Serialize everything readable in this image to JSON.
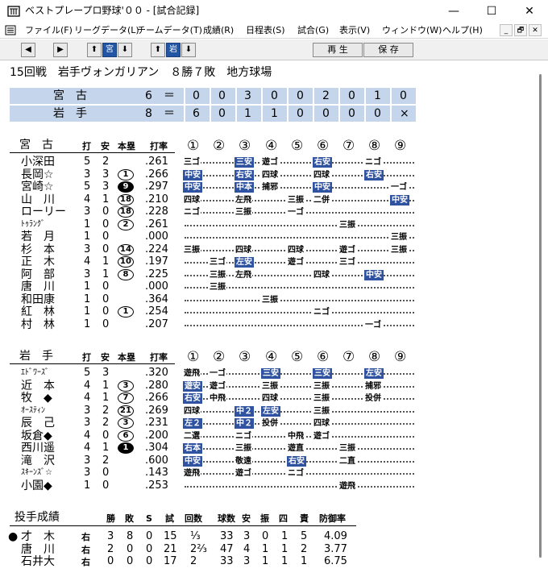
{
  "window": {
    "title": "ベストプレープロ野球'００ - [試合記録]",
    "minimize": "—",
    "maximize": "☐",
    "close": "✕"
  },
  "menu": [
    "ファイル(F)",
    "リーグデータ(L)",
    "チームデータ(T)",
    "成績(R)",
    "日程表(S)",
    "試合(G)",
    "表示(V)",
    "ウィンドウ(W)",
    "ヘルプ(H)"
  ],
  "mdi": {
    "min": "_",
    "restore": "🗗",
    "close": "✕"
  },
  "toolbar": {
    "prev": "◀",
    "next": "▶",
    "up1": "⬆",
    "team1": "宮",
    "down1": "⬇",
    "up2": "⬆",
    "team2": "岩",
    "down2": "⬇",
    "play": "再 生",
    "save": "保 存"
  },
  "game": {
    "info": "15回戦　岩手ヴォンガリアン　８勝７敗　地方球場"
  },
  "score": {
    "rows": [
      {
        "team": "宮　古",
        "total": "6",
        "eq": "＝",
        "innings": [
          "0",
          "0",
          "3",
          "0",
          "0",
          "2",
          "0",
          "1",
          "0"
        ]
      },
      {
        "team": "岩　手",
        "total": "8",
        "eq": "＝",
        "innings": [
          "6",
          "0",
          "1",
          "1",
          "0",
          "0",
          "0",
          "0",
          "×"
        ]
      }
    ]
  },
  "headers": {
    "ab": "打",
    "h": "安",
    "hr": "本塁",
    "avg": "打率",
    "innings": [
      "①",
      "②",
      "③",
      "④",
      "⑤",
      "⑥",
      "⑦",
      "⑧",
      "⑨"
    ]
  },
  "teams": [
    {
      "name": "宮　古",
      "players": [
        {
          "name": "小深田",
          "ab": "5",
          "h": "2",
          "hr": "",
          "hrfill": false,
          "avg": ".261",
          "ev": [
            {
              "i": 0,
              "t": "三ゴ",
              "h": false
            },
            {
              "i": 2,
              "t": "三安",
              "h": true
            },
            {
              "i": 3,
              "t": "遊ゴ",
              "h": false
            },
            {
              "i": 5,
              "t": "右安",
              "h": true
            },
            {
              "i": 7,
              "t": "ニゴ",
              "h": false
            }
          ]
        },
        {
          "name": "長岡☆",
          "ab": "3",
          "h": "3",
          "hr": "1",
          "hrfill": false,
          "avg": ".266",
          "ev": [
            {
              "i": 0,
              "t": "中安",
              "h": true
            },
            {
              "i": 2,
              "t": "右安",
              "h": true
            },
            {
              "i": 3,
              "t": "四球",
              "h": false
            },
            {
              "i": 5,
              "t": "四球",
              "h": false
            },
            {
              "i": 7,
              "t": "右安",
              "h": true
            }
          ]
        },
        {
          "name": "宮崎☆",
          "ab": "5",
          "h": "3",
          "hr": "9",
          "hrfill": true,
          "avg": ".297",
          "ev": [
            {
              "i": 0,
              "t": "中安",
              "h": true
            },
            {
              "i": 2,
              "t": "中本",
              "h": true
            },
            {
              "i": 3,
              "t": "捕邪",
              "h": false
            },
            {
              "i": 5,
              "t": "中安",
              "h": true
            },
            {
              "i": 8,
              "t": "一ゴ",
              "h": false
            }
          ]
        },
        {
          "name": "山　川",
          "ab": "4",
          "h": "1",
          "hr": "18",
          "hrfill": false,
          "avg": ".210",
          "ev": [
            {
              "i": 0,
              "t": "四球",
              "h": false
            },
            {
              "i": 2,
              "t": "左飛",
              "h": false
            },
            {
              "i": 4,
              "t": "三振",
              "h": false
            },
            {
              "i": 5,
              "t": "二併",
              "h": false
            },
            {
              "i": 8,
              "t": "中安",
              "h": true
            }
          ]
        },
        {
          "name": "ローリー",
          "ab": "3",
          "h": "0",
          "hr": "18",
          "hrfill": false,
          "avg": ".228",
          "ev": [
            {
              "i": 0,
              "t": "ニゴ",
              "h": false
            },
            {
              "i": 2,
              "t": "三振",
              "h": false
            },
            {
              "i": 4,
              "t": "一ゴ",
              "h": false
            }
          ]
        },
        {
          "name": "ﾄｩﾗﾝｸﾞ",
          "ab": "1",
          "h": "0",
          "hr": "2",
          "hrfill": false,
          "avg": ".261",
          "ev": [
            {
              "i": 6,
              "t": "三振",
              "h": false
            }
          ]
        },
        {
          "name": "若　月",
          "ab": "1",
          "h": "0",
          "hr": "",
          "hrfill": false,
          "avg": ".000",
          "ev": [
            {
              "i": 8,
              "t": "三振",
              "h": false
            }
          ]
        },
        {
          "name": "杉　本",
          "ab": "3",
          "h": "0",
          "hr": "14",
          "hrfill": false,
          "avg": ".224",
          "ev": [
            {
              "i": 0,
              "t": "三振",
              "h": false
            },
            {
              "i": 2,
              "t": "四球",
              "h": false
            },
            {
              "i": 4,
              "t": "四球",
              "h": false
            },
            {
              "i": 6,
              "t": "遊ゴ",
              "h": false
            },
            {
              "i": 8,
              "t": "三振",
              "h": false
            }
          ]
        },
        {
          "name": "正　木",
          "ab": "4",
          "h": "1",
          "hr": "10",
          "hrfill": false,
          "avg": ".197",
          "ev": [
            {
              "i": 1,
              "t": "三ゴ",
              "h": false
            },
            {
              "i": 2,
              "t": "左安",
              "h": true
            },
            {
              "i": 4,
              "t": "遊ゴ",
              "h": false
            },
            {
              "i": 6,
              "t": "三ゴ",
              "h": false
            }
          ]
        },
        {
          "name": "阿　部",
          "ab": "3",
          "h": "1",
          "hr": "8",
          "hrfill": false,
          "avg": ".225",
          "ev": [
            {
              "i": 1,
              "t": "三振",
              "h": false
            },
            {
              "i": 2,
              "t": "左飛",
              "h": false
            },
            {
              "i": 5,
              "t": "四球",
              "h": false
            },
            {
              "i": 7,
              "t": "中安",
              "h": true
            }
          ]
        },
        {
          "name": "唐　川",
          "ab": "1",
          "h": "0",
          "hr": "",
          "hrfill": false,
          "avg": ".000",
          "ev": [
            {
              "i": 1,
              "t": "三振",
              "h": false
            }
          ]
        },
        {
          "name": "和田康",
          "ab": "1",
          "h": "0",
          "hr": "",
          "hrfill": false,
          "avg": ".364",
          "ev": [
            {
              "i": 3,
              "t": "三振",
              "h": false
            }
          ]
        },
        {
          "name": "紅　林",
          "ab": "1",
          "h": "0",
          "hr": "1",
          "hrfill": false,
          "avg": ".254",
          "ev": [
            {
              "i": 5,
              "t": "ニゴ",
              "h": false
            }
          ]
        },
        {
          "name": "村　林",
          "ab": "1",
          "h": "0",
          "hr": "",
          "hrfill": false,
          "avg": ".207",
          "ev": [
            {
              "i": 7,
              "t": "一ゴ",
              "h": false
            }
          ]
        }
      ]
    },
    {
      "name": "岩　手",
      "players": [
        {
          "name": "ｴﾄﾞﾜｰｽﾞ",
          "ab": "5",
          "h": "3",
          "hr": "",
          "hrfill": false,
          "avg": ".320",
          "ev": [
            {
              "i": 0,
              "t": "遊飛",
              "h": false
            },
            {
              "i": 1,
              "t": "一ゴ",
              "h": false
            },
            {
              "i": 3,
              "t": "三安",
              "h": true
            },
            {
              "i": 5,
              "t": "三安",
              "h": true
            },
            {
              "i": 7,
              "t": "左安",
              "h": true
            }
          ]
        },
        {
          "name": "近　本",
          "ab": "4",
          "h": "1",
          "hr": "3",
          "hrfill": false,
          "avg": ".280",
          "ev": [
            {
              "i": 0,
              "t": "遊安",
              "h": true
            },
            {
              "i": 1,
              "t": "遊ゴ",
              "h": false
            },
            {
              "i": 3,
              "t": "三振",
              "h": false
            },
            {
              "i": 5,
              "t": "三振",
              "h": false
            },
            {
              "i": 7,
              "t": "捕邪",
              "h": false
            }
          ]
        },
        {
          "name": "牧　◆",
          "ab": "4",
          "h": "1",
          "hr": "7",
          "hrfill": false,
          "avg": ".266",
          "ev": [
            {
              "i": 0,
              "t": "右安",
              "h": true
            },
            {
              "i": 1,
              "t": "中飛",
              "h": false
            },
            {
              "i": 3,
              "t": "四球",
              "h": false
            },
            {
              "i": 5,
              "t": "三振",
              "h": false
            },
            {
              "i": 7,
              "t": "投併",
              "h": false
            }
          ]
        },
        {
          "name": "ｵｰｽﾃｨﾝ",
          "ab": "3",
          "h": "2",
          "hr": "21",
          "hrfill": false,
          "avg": ".269",
          "ev": [
            {
              "i": 0,
              "t": "四球",
              "h": false
            },
            {
              "i": 2,
              "t": "中２",
              "h": true
            },
            {
              "i": 3,
              "t": "左安",
              "h": true
            },
            {
              "i": 5,
              "t": "三振",
              "h": false
            }
          ]
        },
        {
          "name": "辰　己",
          "ab": "3",
          "h": "2",
          "hr": "3",
          "hrfill": false,
          "avg": ".231",
          "ev": [
            {
              "i": 0,
              "t": "左２",
              "h": true
            },
            {
              "i": 2,
              "t": "中２",
              "h": true
            },
            {
              "i": 3,
              "t": "投併",
              "h": false
            },
            {
              "i": 5,
              "t": "四球",
              "h": false
            }
          ]
        },
        {
          "name": "坂倉◆",
          "ab": "4",
          "h": "0",
          "hr": "6",
          "hrfill": false,
          "avg": ".200",
          "ev": [
            {
              "i": 0,
              "t": "二選",
              "h": false
            },
            {
              "i": 2,
              "t": "ニゴ",
              "h": false
            },
            {
              "i": 4,
              "t": "中飛",
              "h": false
            },
            {
              "i": 5,
              "t": "遊ゴ",
              "h": false
            }
          ]
        },
        {
          "name": "西川遥",
          "ab": "4",
          "h": "1",
          "hr": "1",
          "hrfill": true,
          "avg": ".304",
          "ev": [
            {
              "i": 0,
              "t": "右本",
              "h": true
            },
            {
              "i": 2,
              "t": "三振",
              "h": false
            },
            {
              "i": 4,
              "t": "遊直",
              "h": false
            },
            {
              "i": 6,
              "t": "三振",
              "h": false
            }
          ]
        },
        {
          "name": "滝　沢",
          "ab": "3",
          "h": "2",
          "hr": "",
          "hrfill": false,
          "avg": ".600",
          "ev": [
            {
              "i": 0,
              "t": "中安",
              "h": true
            },
            {
              "i": 2,
              "t": "敬遠",
              "h": false
            },
            {
              "i": 4,
              "t": "右安",
              "h": true
            },
            {
              "i": 6,
              "t": "二直",
              "h": false
            }
          ]
        },
        {
          "name": "ｽｷｰﾝｽﾞ☆",
          "ab": "3",
          "h": "0",
          "hr": "",
          "hrfill": false,
          "avg": ".143",
          "ev": [
            {
              "i": 0,
              "t": "遊飛",
              "h": false
            },
            {
              "i": 2,
              "t": "遊ゴ",
              "h": false
            },
            {
              "i": 4,
              "t": "ニゴ",
              "h": false
            }
          ]
        },
        {
          "name": "小園◆",
          "ab": "1",
          "h": "0",
          "hr": "",
          "hrfill": false,
          "avg": ".253",
          "ev": [
            {
              "i": 6,
              "t": "遊飛",
              "h": false
            }
          ]
        }
      ]
    }
  ],
  "pitching": {
    "title": "投手成績",
    "headers": [
      "勝",
      "敗",
      "S",
      "試",
      "回数",
      "球数",
      "安",
      "振",
      "四",
      "責",
      "防御率"
    ],
    "rows": [
      {
        "mark": "●",
        "name": "才　木",
        "hand": "右",
        "w": "3",
        "l": "8",
        "s": "0",
        "g": "15",
        "ip": "⅓",
        "np": "33",
        "h": "3",
        "k": "0",
        "bb": "1",
        "er": "5",
        "era": "4.09"
      },
      {
        "mark": "",
        "name": "唐　川",
        "hand": "右",
        "w": "2",
        "l": "0",
        "s": "0",
        "g": "21",
        "ip": "2⅔",
        "np": "47",
        "h": "4",
        "k": "1",
        "bb": "1",
        "er": "2",
        "era": "3.77"
      },
      {
        "mark": "",
        "name": "石井大",
        "hand": "右",
        "w": "0",
        "l": "0",
        "s": "0",
        "g": "17",
        "ip": "2",
        "np": "33",
        "h": "3",
        "k": "1",
        "bb": "1",
        "er": "1",
        "era": "6.75"
      }
    ]
  }
}
